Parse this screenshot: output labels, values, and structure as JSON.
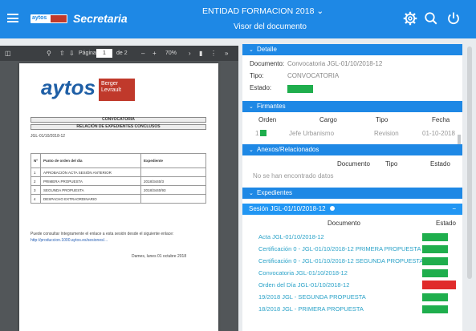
{
  "header": {
    "app_name": "Secretaria",
    "entity": "ENTIDAD FORMACION 2018 ⌄",
    "subtitle": "Visor del documento",
    "logo_text": "aytos",
    "icons": [
      "menu-icon",
      "settings-icon",
      "search-icon",
      "power-icon"
    ]
  },
  "viewer": {
    "toolbar": {
      "page_label": "Página",
      "page_value": "1",
      "page_total": "de 2",
      "zoom": "70%"
    },
    "pdf": {
      "logo": "aytos",
      "partner_logo": "Berger Levrault",
      "doc_type": "CONVOCATORIA",
      "doc_title": "RELACIÓN DE EXPEDIENTES CONCLUSOS",
      "ref": "JGL-01/10/2018-12",
      "table_headers": [
        "Nº",
        "Punto de orden del día",
        "Expediente"
      ],
      "rows": [
        {
          "n": "1",
          "punto": "APROBACIÓN ACTA SESIÓN ANTERIOR",
          "exp": ""
        },
        {
          "n": "2",
          "punto": "PRIMERA PROPUESTA",
          "exp": "2018/3440/3"
        },
        {
          "n": "3",
          "punto": "SEGUNDA PROPUESTA",
          "exp": "2018/3440/93"
        },
        {
          "n": "4",
          "punto": "DESPACHO EXTRAORDINARIO",
          "exp": ""
        }
      ],
      "footer_text": "Puede consultar íntegramente el enlace a esta sesión desde el siguiente enlace:",
      "footer_link": "http://produccion.1000.aytos.es/sesiones/...",
      "signature": "Dames, lunes 01 octubre 2018"
    }
  },
  "detail": {
    "title": "Detalle",
    "documento_label": "Documento:",
    "documento_value": "Convocatoria JGL-01/10/2018-12",
    "tipo_label": "Tipo:",
    "tipo_value": "CONVOCATORIA",
    "estado_label": "Estado:",
    "estado_color": "#1fae4d"
  },
  "firmantes": {
    "title": "Firmantes",
    "headers": [
      "Orden",
      "Cargo",
      "Tipo",
      "Fecha"
    ],
    "rows": [
      {
        "orden": "1",
        "cargo": "Jefe Urbanismo",
        "tipo": "Revision",
        "fecha": "01-10-2018",
        "status_color": "#1fae4d"
      }
    ]
  },
  "anexos": {
    "title": "Anexos/Relacionados",
    "headers": [
      "Documento",
      "Tipo",
      "Estado"
    ],
    "empty_text": "No se han encontrado datos"
  },
  "expedientes": {
    "title": "Expedientes",
    "session_label": "Sesión JGL-01/10/2018-12",
    "collapse_symbol": "−",
    "headers": [
      "Documento",
      "Estado"
    ],
    "items": [
      {
        "doc": "Acta JGL-01/10/2018-12",
        "status_color": "#1fae4d"
      },
      {
        "doc": "Certificación 0 - JGL-01/10/2018-12 PRIMERA PROPUESTA",
        "status_color": "#1fae4d"
      },
      {
        "doc": "Certificación 0 - JGL-01/10/2018-12 SEGUNDA PROPUESTA",
        "status_color": "#1fae4d"
      },
      {
        "doc": "Convocatoria JGL-01/10/2018-12",
        "status_color": "#1fae4d"
      },
      {
        "doc": "Orden del Día JGL-01/10/2018-12",
        "status_color": "#e02b2b"
      },
      {
        "doc": "19/2018 JGL - SEGUNDA PROPUESTA",
        "status_color": "#1fae4d"
      },
      {
        "doc": "18/2018 JGL - PRIMERA PROPUESTA",
        "status_color": "#1fae4d"
      }
    ]
  }
}
